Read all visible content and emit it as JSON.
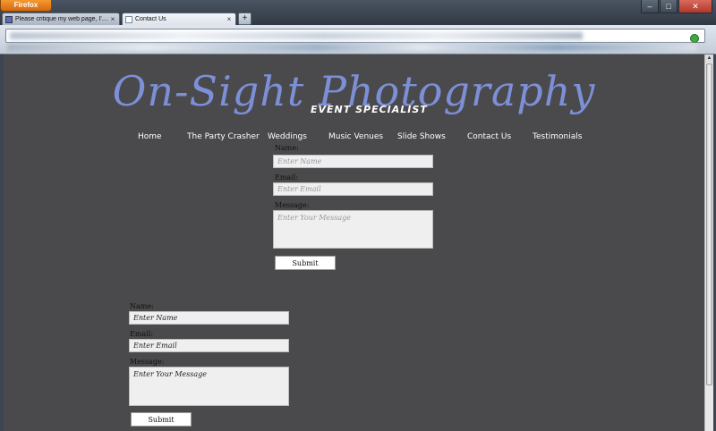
{
  "browser": {
    "app_button_label": "Firefox",
    "tabs": [
      {
        "title": "Please critique my web page, I'm so s...",
        "active": false
      },
      {
        "title": "Contact Us",
        "active": true
      }
    ],
    "new_tab_label": "+",
    "window_controls": {
      "minimize": "–",
      "maximize": "□",
      "close": "✕"
    }
  },
  "page": {
    "logo_title": "On-Sight Photography",
    "logo_subtitle": "EVENT SPECIALIST",
    "nav": [
      "Home",
      "The Party Crasher",
      "Weddings",
      "Music Venues",
      "Slide Shows",
      "Contact Us",
      "Testimonials"
    ],
    "form_top": {
      "name_label": "Name:",
      "name_placeholder": "Enter Name",
      "email_label": "Email:",
      "email_placeholder": "Enter Email",
      "message_label": "Message:",
      "message_placeholder": "Enter Your Message",
      "submit_label": "Submit"
    },
    "form_bottom": {
      "name_label": "Name:",
      "name_placeholder": "Enter Name",
      "email_label": "Email:",
      "email_placeholder": "Enter Email",
      "message_label": "Message:",
      "message_placeholder": "Enter Your Message",
      "submit_label": "Submit"
    }
  },
  "colors": {
    "page_background": "#4a4a4c",
    "logo": "#7d8fd6",
    "nav_text": "#ffffff",
    "field_background": "#efefef"
  }
}
